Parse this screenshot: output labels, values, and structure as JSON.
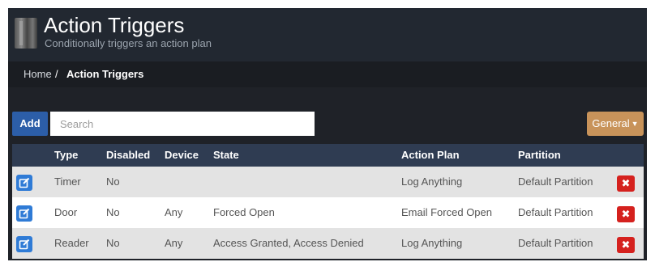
{
  "header": {
    "title": "Action Triggers",
    "subtitle": "Conditionally triggers an action plan"
  },
  "breadcrumb": {
    "home": "Home",
    "separator": "/",
    "current": "Action Triggers"
  },
  "toolbar": {
    "add_label": "Add",
    "search_placeholder": "Search",
    "search_value": "",
    "general_label": "General"
  },
  "table": {
    "columns": [
      "Type",
      "Disabled",
      "Device",
      "State",
      "Action Plan",
      "Partition"
    ],
    "rows": [
      {
        "type": "Timer",
        "disabled": "No",
        "device": "",
        "state": "",
        "action_plan": "Log Anything",
        "partition": "Default Partition"
      },
      {
        "type": "Door",
        "disabled": "No",
        "device": "Any",
        "state": "Forced Open",
        "action_plan": "Email Forced Open",
        "partition": "Default Partition"
      },
      {
        "type": "Reader",
        "disabled": "No",
        "device": "Any",
        "state": "Access Granted, Access Denied",
        "action_plan": "Log Anything",
        "partition": "Default Partition"
      }
    ],
    "edit_icon": "edit-icon",
    "delete_icon": "delete-icon",
    "delete_glyph": "✖"
  },
  "colors": {
    "header_bg": "#222831",
    "breadcrumb_bg": "#1a1d22",
    "add_button": "#2c5ea8",
    "general_button": "#c8935a",
    "table_header": "#2f3c52",
    "edit_button": "#2f7bd6",
    "delete_button": "#d5211e"
  }
}
